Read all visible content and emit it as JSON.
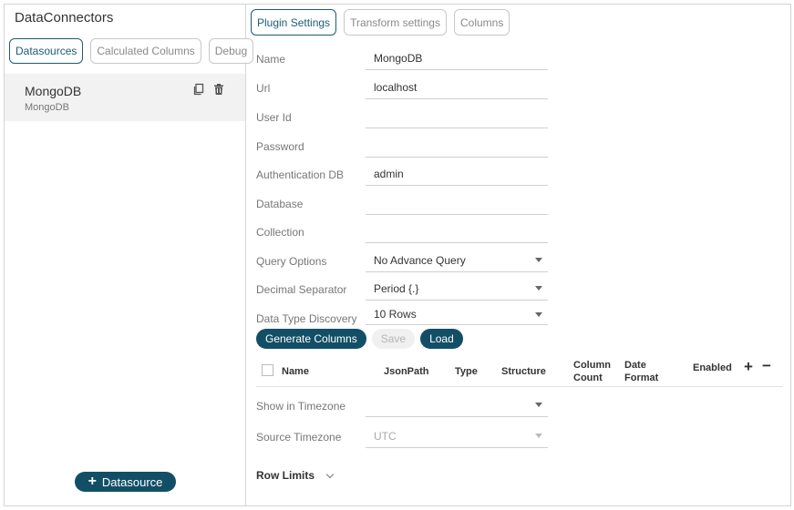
{
  "app": {
    "title": "DataConnectors"
  },
  "left_tabs": [
    "Datasources",
    "Calculated Columns",
    "Debug"
  ],
  "datasource": {
    "name": "MongoDB",
    "type": "MongoDB"
  },
  "add_datasource_label": "Datasource",
  "right_tabs": [
    "Plugin Settings",
    "Transform settings",
    "Columns"
  ],
  "fields": {
    "name": {
      "label": "Name",
      "value": "MongoDB"
    },
    "url": {
      "label": "Url",
      "value": "localhost"
    },
    "user_id": {
      "label": "User Id",
      "value": ""
    },
    "password": {
      "label": "Password",
      "value": ""
    },
    "auth_db": {
      "label": "Authentication DB",
      "value": "admin"
    },
    "database": {
      "label": "Database",
      "value": ""
    },
    "collection": {
      "label": "Collection",
      "value": ""
    },
    "query_options": {
      "label": "Query Options",
      "value": "No Advance Query"
    },
    "decimal_separator": {
      "label": "Decimal Separator",
      "value": "Period {.}"
    },
    "data_type_discovery": {
      "label": "Data Type Discovery",
      "value": "10 Rows"
    },
    "show_in_timezone": {
      "label": "Show in Timezone",
      "value": ""
    },
    "source_timezone": {
      "label": "Source Timezone",
      "value": "UTC"
    }
  },
  "buttons": {
    "generate": "Generate Columns",
    "save": "Save",
    "load": "Load"
  },
  "columns_header": {
    "name": "Name",
    "jsonpath": "JsonPath",
    "type": "Type",
    "structure": "Structure",
    "column_count_1": "Column",
    "column_count_2": "Count",
    "date_format_1": "Date",
    "date_format_2": "Format",
    "enabled": "Enabled",
    "add": "+",
    "remove": "−"
  },
  "row_limits": "Row Limits"
}
